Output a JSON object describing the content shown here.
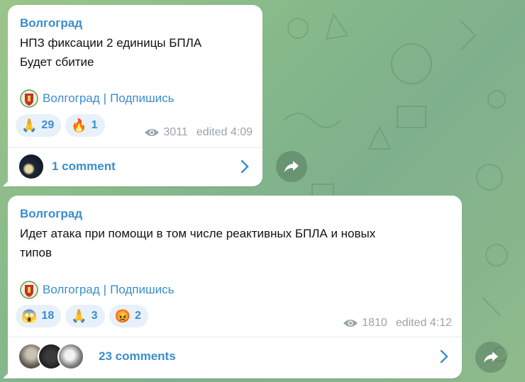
{
  "posts": [
    {
      "channel": "Волгоград",
      "lines": [
        "НПЗ фиксации 2 единицы БПЛА",
        "Будет сбитие"
      ],
      "signature": {
        "channel_link": "Волгоград",
        "separator": "|",
        "subscribe": "Подпишись"
      },
      "reactions": [
        {
          "emoji": "🙏",
          "count": "29"
        },
        {
          "emoji": "🔥",
          "count": "1"
        }
      ],
      "views": "3011",
      "edited": "edited 4:09",
      "comments_label": "1 comment"
    },
    {
      "channel": "Волгоград",
      "lines": [
        "Идет атака при помощи в том числе реактивных БПЛА и новых",
        "типов"
      ],
      "signature": {
        "channel_link": "Волгоград",
        "separator": "|",
        "subscribe": "Подпишись"
      },
      "reactions": [
        {
          "emoji": "😱",
          "count": "18"
        },
        {
          "emoji": "🙏",
          "count": "3"
        },
        {
          "emoji": "😡",
          "count": "2"
        }
      ],
      "views": "1810",
      "edited": "edited 4:12",
      "comments_label": "23 comments"
    }
  ],
  "colors": {
    "accent": "#3a8dcc",
    "bubble": "#ffffff",
    "meta": "#9aa4ad"
  },
  "icons": [
    "emblem-icon",
    "eye-icon",
    "chevron-right-icon",
    "share-arrow-icon"
  ]
}
